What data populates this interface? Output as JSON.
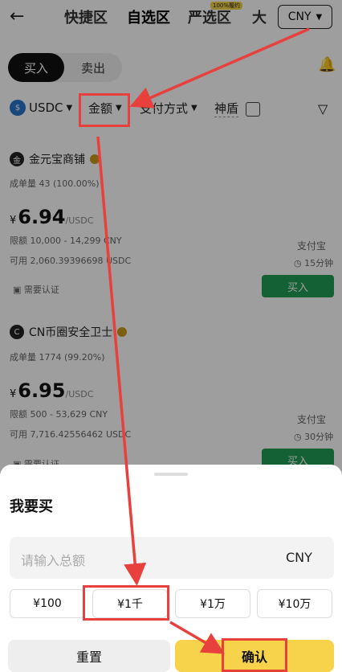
{
  "header": {
    "back_icon": "arrow-left-icon",
    "tabs": [
      {
        "label": "快捷区"
      },
      {
        "label": "自选区"
      },
      {
        "label": "严选区"
      },
      {
        "label": "大"
      }
    ],
    "badge": "100%履约",
    "currency": "CNY"
  },
  "toggle": {
    "buy": "买入",
    "sell": "卖出"
  },
  "filters": {
    "coin": "USDC",
    "amount": "金额",
    "payment": "支付方式",
    "shield": "神盾"
  },
  "merchants": [
    {
      "avatar": "金",
      "name": "金元宝商铺",
      "volume_label": "成单量",
      "volume": "43 (100.00%)",
      "currency_symbol": "¥",
      "price": "6.94",
      "price_unit": "/USDC",
      "limit_label": "限额",
      "limit": "10,000 - 14,299 CNY",
      "avail_label": "可用",
      "available": "2,060.39396698 USDC",
      "payment": "支付宝",
      "time": "15分钟",
      "auth": "需要认证",
      "button": "买入"
    },
    {
      "avatar": "C",
      "name": "CN币圈安全卫士",
      "volume_label": "成单量",
      "volume": "1774 (99.20%)",
      "currency_symbol": "¥",
      "price": "6.95",
      "price_unit": "/USDC",
      "limit_label": "限额",
      "limit": "500 - 53,629 CNY",
      "avail_label": "可用",
      "available": "7,716.42556462 USDC",
      "payment": "支付宝",
      "time": "30分钟",
      "auth": "需要认证",
      "button": "买入"
    }
  ],
  "sheet": {
    "title": "我要买",
    "placeholder": "请输入总额",
    "currency": "CNY",
    "quick_amounts": [
      "¥100",
      "¥1千",
      "¥1万",
      "¥10万"
    ],
    "reset": "重置",
    "confirm": "确认"
  },
  "colors": {
    "accent": "#f6d34a",
    "buy_green": "#1f9d55",
    "annotation": "#e8403c"
  }
}
